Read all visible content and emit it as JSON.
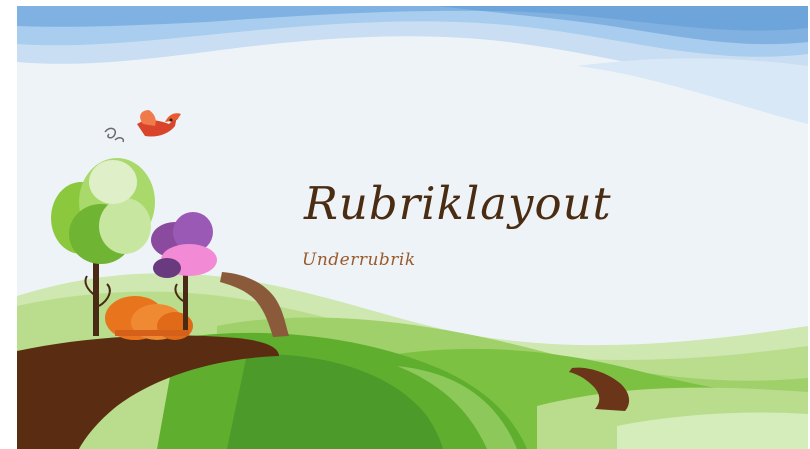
{
  "slide": {
    "title": "Rubriklayout",
    "subtitle": "Underrubrik",
    "colors": {
      "sky_light": "#eef3f8",
      "sky_wave": "#9fc7ee",
      "sky_wave_deep": "#6fa6de",
      "hill_light": "#b9dd8c",
      "hill_mid": "#7cc142",
      "hill_dark": "#4c9a2a",
      "path_brown": "#5a2d12",
      "title_text": "#4a2c12",
      "subtitle_text": "#9a5a2a"
    },
    "decorations": [
      "bird-icon",
      "green-tree-icon",
      "purple-tree-icon",
      "orange-bush-icon",
      "dirt-path",
      "rolling-hills",
      "sky-waves"
    ]
  }
}
